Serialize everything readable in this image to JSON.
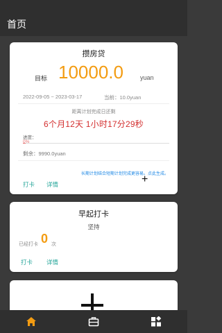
{
  "header": {
    "title": "首页"
  },
  "plan_card": {
    "title": "攒房贷",
    "goal_label": "目标",
    "goal_value": "10000.0",
    "goal_unit": "yuan",
    "date_range": "2022-09-05 ~ 2023-03-17",
    "current": "当前：10.0yuan",
    "countdown_label": "距离计划完成日还剩",
    "countdown": "6个月12天 1小时17分29秒",
    "progress_label": "进度：",
    "progress_percent": "0%",
    "progress_fraction": 0.001,
    "remaining": "剩余：9990.0yuan",
    "note": "长期计划结合短期计划完成更容易。点此生成。",
    "checkin_label": "打卡",
    "details_label": "详情",
    "add_symbol": "+"
  },
  "habit_card": {
    "title": "早起打卡",
    "motto": "坚持",
    "done_label": "已经打卡",
    "done_count": "0",
    "done_unit": "次",
    "checkin_label": "打卡",
    "details_label": "详情"
  },
  "add_card": {
    "icon": "plus-icon"
  },
  "bottom_nav": {
    "items": [
      {
        "icon": "home-icon",
        "active": true
      },
      {
        "icon": "briefcase-icon",
        "active": false
      },
      {
        "icon": "apps-icon",
        "active": false
      }
    ]
  },
  "colors": {
    "accent": "#f39c12",
    "countdown": "#d32f2f",
    "action": "#26a69a",
    "link": "#1e88e5"
  }
}
